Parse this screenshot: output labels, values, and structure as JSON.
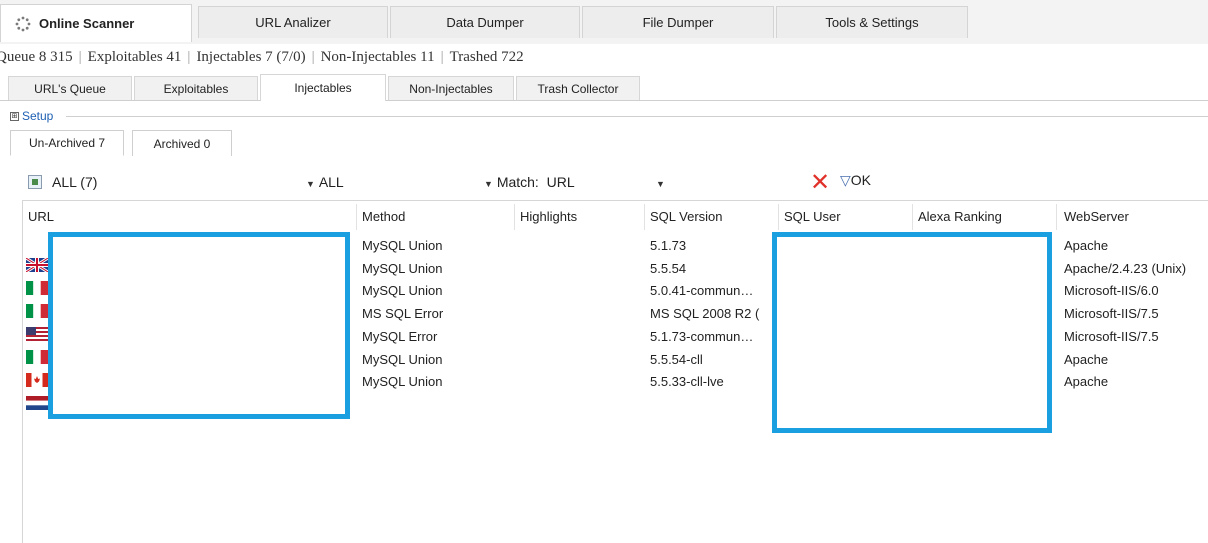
{
  "main_tabs": [
    {
      "label": "Online Scanner",
      "active": true
    },
    {
      "label": "URL Analizer"
    },
    {
      "label": "Data Dumper"
    },
    {
      "label": "File Dumper"
    },
    {
      "label": "Tools & Settings"
    }
  ],
  "stats": {
    "queue": "Queue 8 315",
    "exploitables": "Exploitables 41",
    "injectables": "Injectables 7 (7/0)",
    "non_injectables": "Non-Injectables 11",
    "trashed": "Trashed 722"
  },
  "sub_tabs": [
    {
      "label": "URL's Queue"
    },
    {
      "label": "Exploitables"
    },
    {
      "label": "Injectables",
      "active": true
    },
    {
      "label": "Non-Injectables"
    },
    {
      "label": "Trash Collector"
    }
  ],
  "setup": {
    "label": "Setup",
    "expander": "⊞"
  },
  "archive_tabs": [
    {
      "label": "Un-Archived 7",
      "active": true
    },
    {
      "label": "Archived 0"
    }
  ],
  "filter": {
    "view": "ALL (7)",
    "second": "ALL",
    "match_label": "Match:",
    "match_value": "URL",
    "ok_label": "OK"
  },
  "columns": [
    "URL",
    "Method",
    "Highlights",
    "SQL Version",
    "SQL User",
    "Alexa Ranking",
    "WebServer"
  ],
  "rows": [
    {
      "flag": "gb",
      "method": "MySQL Union",
      "sql_version": "5.1.73",
      "webserver": "Apache"
    },
    {
      "flag": "it",
      "method": "MySQL Union",
      "sql_version": "5.5.54",
      "webserver": "Apache/2.4.23 (Unix)"
    },
    {
      "flag": "it",
      "method": "MySQL Union",
      "sql_version": "5.0.41-commun…",
      "webserver": "Microsoft-IIS/6.0"
    },
    {
      "flag": "us",
      "method": "MS SQL Error",
      "sql_version": "MS SQL 2008 R2 (",
      "webserver": "Microsoft-IIS/7.5"
    },
    {
      "flag": "it",
      "method": "MySQL Error",
      "sql_version": "5.1.73-commun…",
      "webserver": "Microsoft-IIS/7.5"
    },
    {
      "flag": "ca",
      "method": "MySQL Union",
      "sql_version": "5.5.54-cll",
      "webserver": "Apache"
    },
    {
      "flag": "nl",
      "method": "MySQL Union",
      "sql_version": "5.5.33-cll-lve",
      "webserver": "Apache"
    }
  ],
  "colors": {
    "redaction": "#1a9fe0",
    "delete_icon": "#e0312a"
  },
  "icons": [
    "spinner-icon",
    "grid-icon",
    "dropdown-arrow-icon",
    "delete-icon",
    "apply-filter-icon"
  ]
}
